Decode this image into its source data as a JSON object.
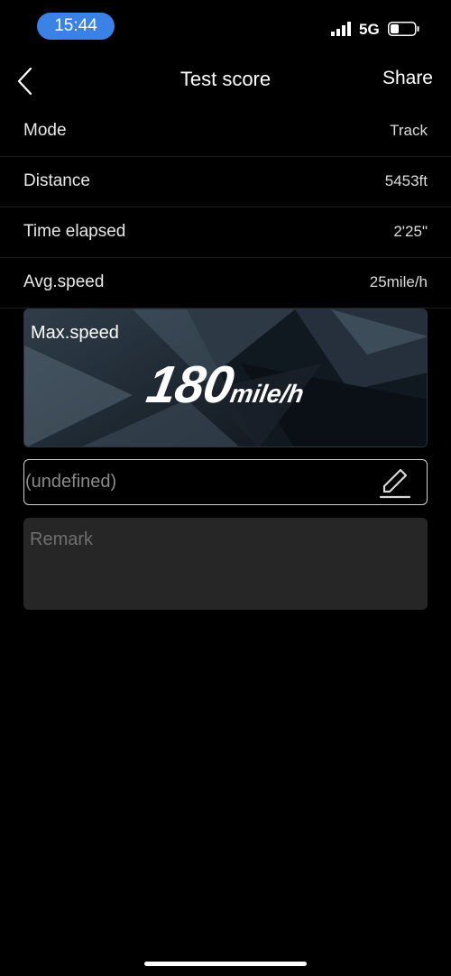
{
  "status_bar": {
    "time": "15:44",
    "network": "5G",
    "icons": [
      "signal-icon",
      "battery-icon"
    ]
  },
  "nav": {
    "title": "Test score",
    "share_label": "Share",
    "back_icon": "chevron-left-icon"
  },
  "rows": [
    {
      "label": "Mode",
      "value": "Track"
    },
    {
      "label": "Distance",
      "value": "5453ft"
    },
    {
      "label": "Time elapsed",
      "value": "2'25\""
    },
    {
      "label": "Avg.speed",
      "value": "25mile/h"
    }
  ],
  "max_speed": {
    "label": "Max.speed",
    "value": "180",
    "unit": "mile/h"
  },
  "name_field": {
    "value": "(undefined)",
    "edit_icon": "pencil-icon"
  },
  "remark": {
    "placeholder": "Remark"
  },
  "colors": {
    "background": "#000000",
    "time_pill": "#3b82e6",
    "remark_bg": "#262626"
  }
}
